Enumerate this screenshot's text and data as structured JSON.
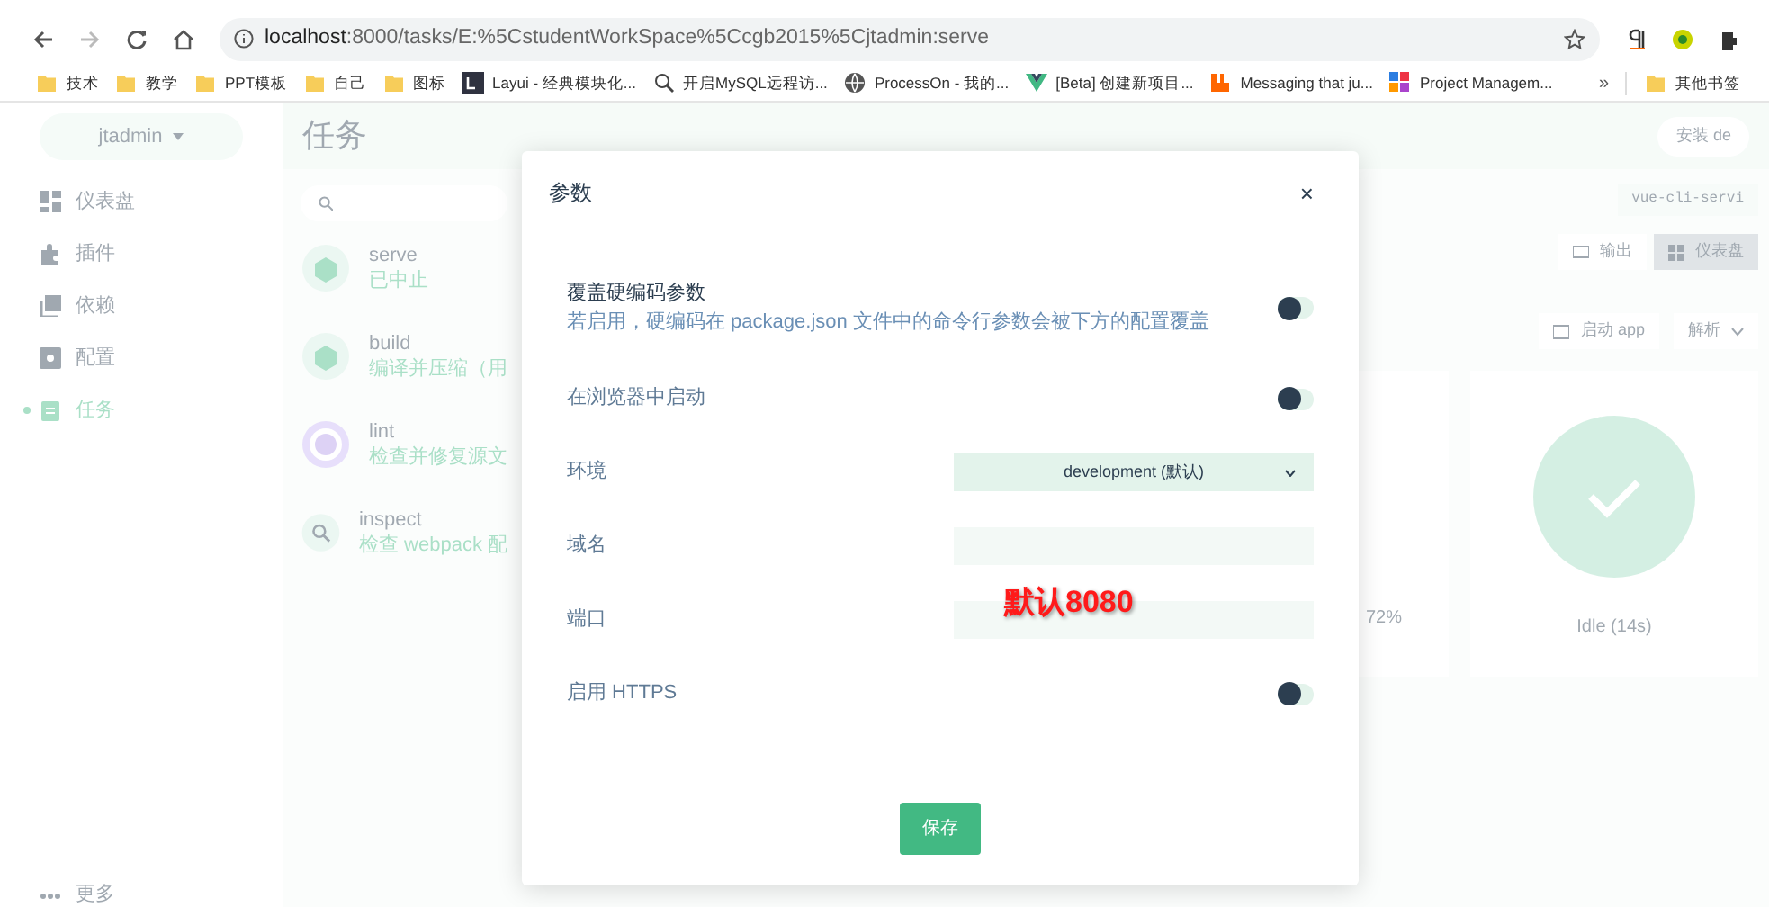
{
  "browser": {
    "url_host": "localhost",
    "url_rest": ":8000/tasks/E:%5CstudentWorkSpace%5Ccgb2015%5Cjtadmin:serve",
    "bookmarks": [
      {
        "kind": "folder",
        "label": "技术"
      },
      {
        "kind": "folder",
        "label": "教学"
      },
      {
        "kind": "folder",
        "label": "PPT模板"
      },
      {
        "kind": "folder",
        "label": "自己"
      },
      {
        "kind": "folder",
        "label": "图标"
      },
      {
        "kind": "layui",
        "label": "Layui - 经典模块化..."
      },
      {
        "kind": "tool",
        "label": "开启MySQL远程访..."
      },
      {
        "kind": "globe",
        "label": "ProcessOn - 我的..."
      },
      {
        "kind": "vue",
        "label": "[Beta] 创建新项目..."
      },
      {
        "kind": "rabbit",
        "label": "Messaging that ju..."
      },
      {
        "kind": "grid",
        "label": "Project Managem..."
      }
    ],
    "more": "»",
    "other_bookmarks": "其他书签"
  },
  "sidebar": {
    "project": "jtadmin",
    "items": [
      {
        "kind": "dashboard",
        "label": "仪表盘",
        "selected": false
      },
      {
        "kind": "plugin",
        "label": "插件",
        "selected": false
      },
      {
        "kind": "deps",
        "label": "依赖",
        "selected": false
      },
      {
        "kind": "config",
        "label": "配置",
        "selected": false
      },
      {
        "kind": "tasks",
        "label": "任务",
        "selected": true
      }
    ],
    "more": "更多"
  },
  "page": {
    "title": "任务",
    "install_button": "安装 de",
    "command": "vue-cli-servi",
    "tasks": [
      {
        "name": "serve",
        "description": "已中止",
        "kind": "cube"
      },
      {
        "name": "build",
        "description": "编译并压缩（用",
        "kind": "cube"
      },
      {
        "name": "lint",
        "description": "检查并修复源文",
        "kind": "ring"
      },
      {
        "name": "inspect",
        "description": "检查 webpack 配",
        "kind": "search"
      }
    ],
    "view_tabs": [
      {
        "label": "输出",
        "selected": false
      },
      {
        "label": "仪表盘",
        "selected": true
      }
    ],
    "run_app": "启动 app",
    "analyze": "解析",
    "percent": "72%",
    "status": "Idle (14s)"
  },
  "dialog": {
    "title": "参数",
    "close": "×",
    "save": "保存",
    "fields": [
      {
        "kind": "switch",
        "label": "覆盖硬编码参数",
        "description": "若启用，硬编码在 package.json 文件中的命令行参数会被下方的配置覆盖",
        "on": false
      },
      {
        "kind": "switch",
        "label": "在浏览器中启动",
        "on": false
      },
      {
        "kind": "select",
        "label": "环境",
        "value": "development (默认)"
      },
      {
        "kind": "text",
        "label": "域名"
      },
      {
        "kind": "text",
        "label": "端口"
      },
      {
        "kind": "switch",
        "label": "启用 HTTPS",
        "on": false
      }
    ]
  },
  "annotation": "默认8080"
}
